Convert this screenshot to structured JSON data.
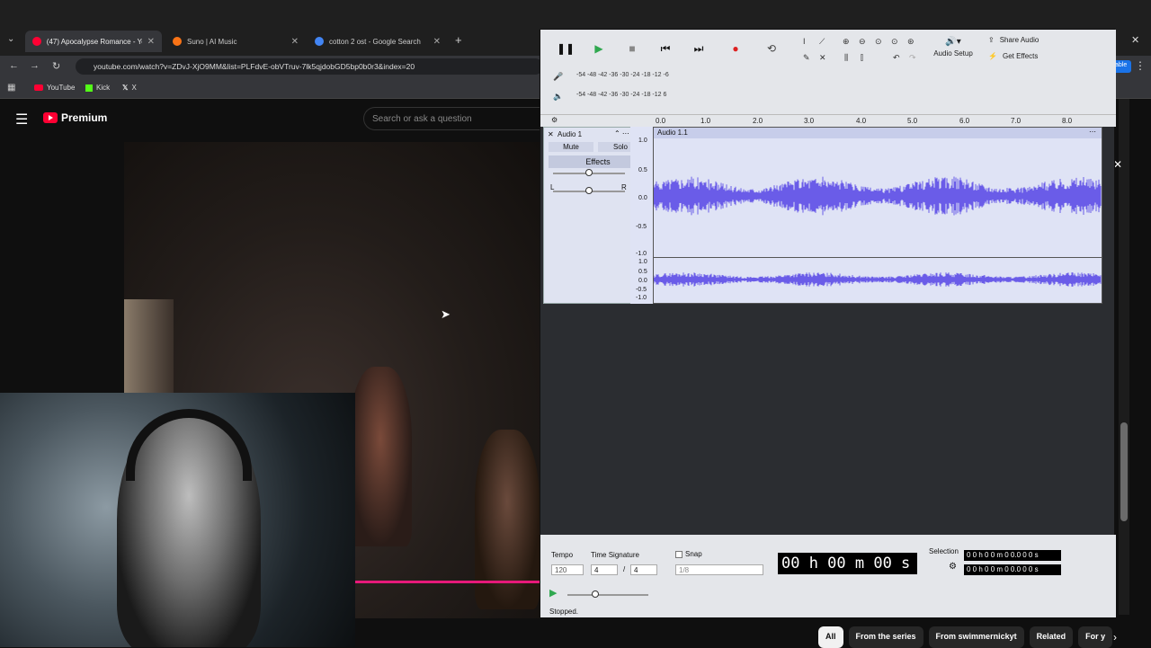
{
  "browser": {
    "tabs": [
      {
        "title": "(47) Apocalypse Romance - Yo",
        "color": "#ff0033"
      },
      {
        "title": "Suno | AI Music",
        "color": "#f97316"
      },
      {
        "title": "cotton 2 ost - Google Search",
        "color": "#4285f4"
      }
    ],
    "url": "youtube.com/watch?v=ZDvJ-XjO9MM&list=PLFdvE-obVTruv-7lk5qjdobGD5bp0b0r3&index=20",
    "bookmarks": [
      "YouTube",
      "Kick",
      "X"
    ]
  },
  "youtube": {
    "brand": "Premium",
    "search_placeholder": "Search or ask a question",
    "chips": [
      "All",
      "From the series",
      "From swimmernickyt",
      "Related",
      "For y"
    ]
  },
  "audacity": {
    "audio_setup": "Audio Setup",
    "share_audio": "Share Audio",
    "get_effects": "Get Effects",
    "meter_ticks": "-54 -48 -42 -36 -30 -24 -18 -12  -6",
    "meter_ticks_short": "-54 -48 -42 -36 -30 -24 -18 -12  6",
    "ruler": [
      "0.0",
      "1.0",
      "2.0",
      "3.0",
      "4.0",
      "5.0",
      "6.0",
      "7.0",
      "8.0"
    ],
    "track_name": "Audio 1",
    "clip_name": "Audio 1.1",
    "mute": "Mute",
    "solo": "Solo",
    "effects": "Effects",
    "pan_left": "L",
    "pan_right": "R",
    "scale_top": [
      "1.0",
      "0.5",
      "0.0",
      "-0.5",
      "-1.0"
    ],
    "scale_bottom": [
      "1.0",
      "0.5",
      "0.0",
      "-0.5",
      "-1.0"
    ],
    "tempo_label": "Tempo",
    "tempo_value": "120",
    "timesig_label": "Time Signature",
    "timesig_num": "4",
    "timesig_den": "4",
    "snap_label": "Snap",
    "snap_value": "1/8",
    "time_display": "00 h 00 m 00 s",
    "selection_label": "Selection",
    "selection_start": "0 0 h 0 0 m 0 0.0 0 0 s",
    "selection_end": "0 0 h 0 0 m 0 0.0 0 0 s",
    "status": "Stopped.",
    "waveform_color": "#6a5ce8"
  }
}
